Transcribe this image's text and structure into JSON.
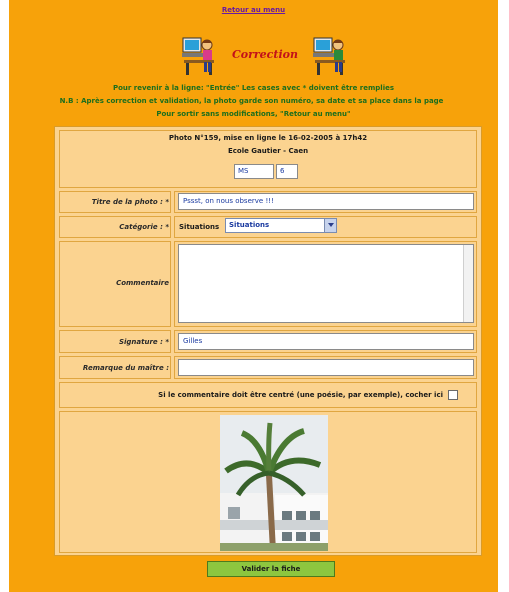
{
  "nav": {
    "back_link": "Retour au menu"
  },
  "header": {
    "title": "Correction"
  },
  "info": {
    "line1": "Pour revenir à la ligne: \"Entrée\"   Les cases avec * doivent être remplies",
    "line2": "N.B : Après correction et validation, la photo garde son numéro, sa date et sa place dans la page",
    "line3": "Pour sortir sans modifications, \"Retour au menu\""
  },
  "photo_header": {
    "line1": "Photo N°159, mise en ligne le 16-02-2005 à 17h42",
    "line2": "Ecole Gautier - Caen",
    "field1": "MS",
    "field2": "6"
  },
  "form": {
    "title_label": "Titre de la photo : *",
    "title_value": "Pssst, on nous observe !!!",
    "category_label": "Catégorie : *",
    "category_prefix": "Situations",
    "category_value": "Situations",
    "comment_label": "Commentaire",
    "signature_label": "Signature : *",
    "signature_value": "Gilles",
    "teacher_label": "Remarque du maître :",
    "teacher_value": "",
    "center_label": "Si le commentaire doit être centré (une poésie, par exemple), cocher ici"
  },
  "submit": {
    "label": "Valider la fiche"
  },
  "colors": {
    "background": "#f7a20a",
    "panel": "#fbd390",
    "title": "#c2101a",
    "info_text": "#1d6e1d",
    "submit": "#8dc63f"
  }
}
